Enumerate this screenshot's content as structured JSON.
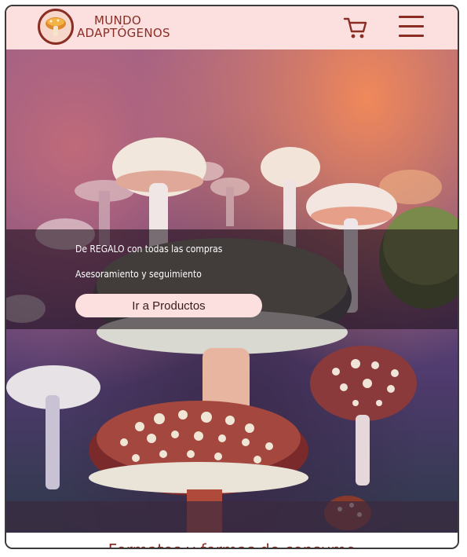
{
  "header": {
    "brand_line1": "MUNDO",
    "brand_line2": "ADAPTÓGENOS",
    "logo_icon": "mushroom-logo-icon",
    "cart_icon": "cart-icon",
    "menu_icon": "hamburger-menu-icon",
    "colors": {
      "background": "#fbe0df",
      "brand": "#8a2e25"
    }
  },
  "hero": {
    "line1": "De REGALO con todas las compras",
    "line2": "Asesoramiento y seguimiento",
    "cta_label": "Ir a Productos",
    "image": "mushroom-forest-illustration"
  },
  "section": {
    "heading": "Formatos y formas de consumo"
  }
}
